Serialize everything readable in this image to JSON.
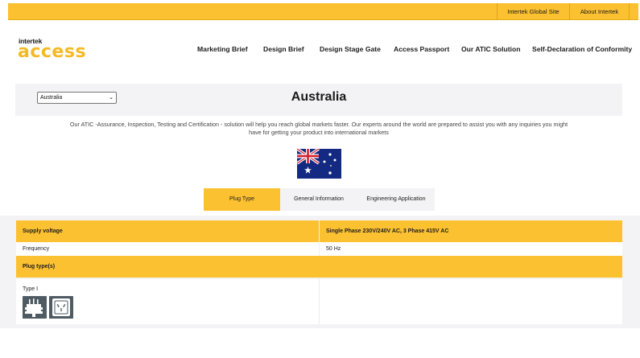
{
  "topbar": {
    "global_site": "Intertek Global Site",
    "about": "About Intertek"
  },
  "logo": {
    "small_text": "intertek",
    "big_text": "access"
  },
  "nav": {
    "items": [
      "Marketing Brief",
      "Design Brief",
      "Design Stage Gate",
      "Access Passport",
      "Our ATIC Solution",
      "Self-Declaration of Conformity"
    ]
  },
  "country": {
    "selected": "Australia",
    "title": "Australia"
  },
  "intro": {
    "line1": "Our ATIC -Assurance, Inspection, Testing and Certification - solution will help you reach global markets faster. Our experts around the world are prepared to assist you with any inquiries you might",
    "line2": "have for getting your product into international markets"
  },
  "tabs": [
    "Plug Type",
    "General Information",
    "Engineering Application"
  ],
  "table": {
    "supply_label": "Supply voltage",
    "supply_value": "Single Phase 230V/240V AC, 3 Phase 415V AC",
    "frequency_label": "Frequency",
    "frequency_value": "50 Hz",
    "plug_types_label": "Plug type(s)",
    "plug_type": "Type I"
  },
  "colors": {
    "accent": "#fcc131",
    "panel": "#f3f3f5",
    "plug_icon": "#4e5b63"
  }
}
